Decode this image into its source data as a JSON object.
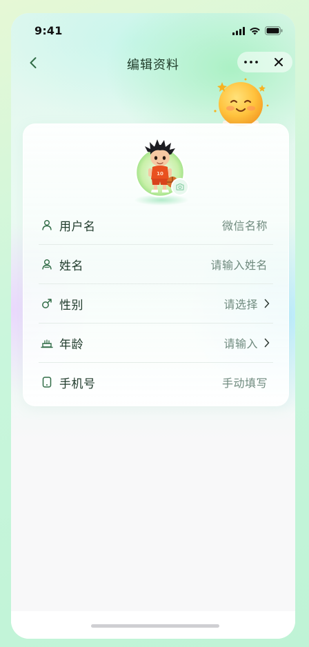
{
  "status_bar": {
    "time": "9:41",
    "icons": [
      "cellular-signal-icon",
      "wifi-icon",
      "battery-icon"
    ]
  },
  "nav": {
    "title": "编辑资料",
    "back_icon": "chevron-left-icon",
    "more_icon": "more-dots-icon",
    "close_icon": "close-icon"
  },
  "profile": {
    "avatar": "avatar-basketball-boy",
    "camera_icon": "camera-icon"
  },
  "form": {
    "rows": [
      {
        "icon": "user-icon",
        "label": "用户名",
        "value": "微信名称",
        "has_arrow": false
      },
      {
        "icon": "user-icon",
        "label": "姓名",
        "value": "请输入姓名",
        "has_arrow": false
      },
      {
        "icon": "gender-male-icon",
        "label": "性别",
        "value": "请选择",
        "has_arrow": true
      },
      {
        "icon": "cake-icon",
        "label": "年龄",
        "value": "请输入",
        "has_arrow": true
      },
      {
        "icon": "phone-icon",
        "label": "手机号",
        "value": "手动填写",
        "has_arrow": false
      }
    ]
  },
  "colors": {
    "accent_green": "#2f6b45",
    "label_text": "#1f3a2b",
    "placeholder_text": "#6f8a7e",
    "divider": "#e4ece8"
  }
}
